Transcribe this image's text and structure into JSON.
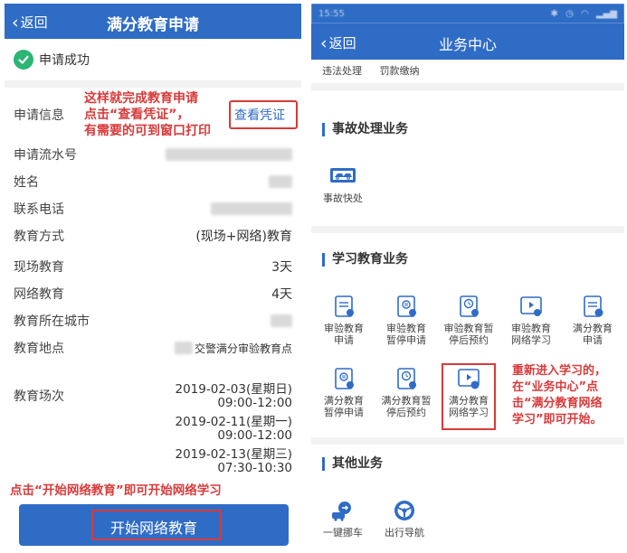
{
  "left": {
    "header": {
      "back_label": "返回",
      "title": "满分教育申请"
    },
    "success_text": "申请成功",
    "info_label": "申请信息",
    "voucher_link": "查看凭证",
    "annotation_top": [
      "这样就完成教育申请",
      "点击“查看凭证”，",
      "有需要的可到窗口打印"
    ],
    "fields": [
      {
        "key": "申请流水号",
        "value": ""
      },
      {
        "key": "姓名",
        "value": ""
      },
      {
        "key": "联系电话",
        "value": ""
      },
      {
        "key": "教育方式",
        "value": "(现场+网络)教育"
      },
      {
        "key": "现场教育",
        "value": "3天"
      },
      {
        "key": "网络教育",
        "value": "4天"
      },
      {
        "key": "教育所在城市",
        "value": ""
      },
      {
        "key": "教育地点",
        "value": "交警满分审验教育点"
      }
    ],
    "sessions_label": "教育场次",
    "sessions": [
      {
        "date": "2019-02-03(星期日)",
        "time": "09:00-12:00"
      },
      {
        "date": "2019-02-11(星期一)",
        "time": "09:00-12:00"
      },
      {
        "date": "2019-02-13(星期三)",
        "time": "07:30-10:30"
      }
    ],
    "annotation_bottom": "点击“开始网络教育”即可开始网络学习",
    "start_button": "开始网络教育",
    "colors": {
      "primary": "#2f6cc6",
      "annotation": "#d83a3a",
      "success": "#2bb673"
    }
  },
  "right": {
    "status_time": "15:55",
    "header": {
      "back_label": "返回",
      "title": "业务中心"
    },
    "top_links": [
      "违法处理",
      "罚款缴纳"
    ],
    "sections": {
      "accident": {
        "title": "事故处理业务",
        "items": [
          {
            "label": "事故快处",
            "icon": "car-accident-icon"
          }
        ]
      },
      "study": {
        "title": "学习教育业务",
        "items": [
          {
            "l1": "审验教育",
            "l2": "申请",
            "icon": "document-icon"
          },
          {
            "l1": "审验教育",
            "l2": "暂停申请",
            "icon": "pause-doc-icon"
          },
          {
            "l1": "审验教育暂",
            "l2": "停后预约",
            "icon": "clock-doc-icon"
          },
          {
            "l1": "审验教育",
            "l2": "网络学习",
            "icon": "video-icon"
          },
          {
            "l1": "满分教育",
            "l2": "申请",
            "icon": "document-12-icon"
          },
          {
            "l1": "满分教育",
            "l2": "暂停申请",
            "icon": "pause-doc-icon"
          },
          {
            "l1": "满分教育暂",
            "l2": "停后预约",
            "icon": "clock-doc-icon"
          },
          {
            "l1": "满分教育",
            "l2": "网络学习",
            "icon": "video-12-icon"
          }
        ]
      },
      "other": {
        "title": "其他业务",
        "items": [
          {
            "label": "一键挪车",
            "icon": "move-car-icon"
          },
          {
            "label": "出行导航",
            "icon": "steering-wheel-icon"
          }
        ]
      }
    },
    "annotation": [
      "重新进入学习的，",
      "在“业务中心”点",
      "击“满分教育网络",
      "学习”即可开始。"
    ]
  }
}
